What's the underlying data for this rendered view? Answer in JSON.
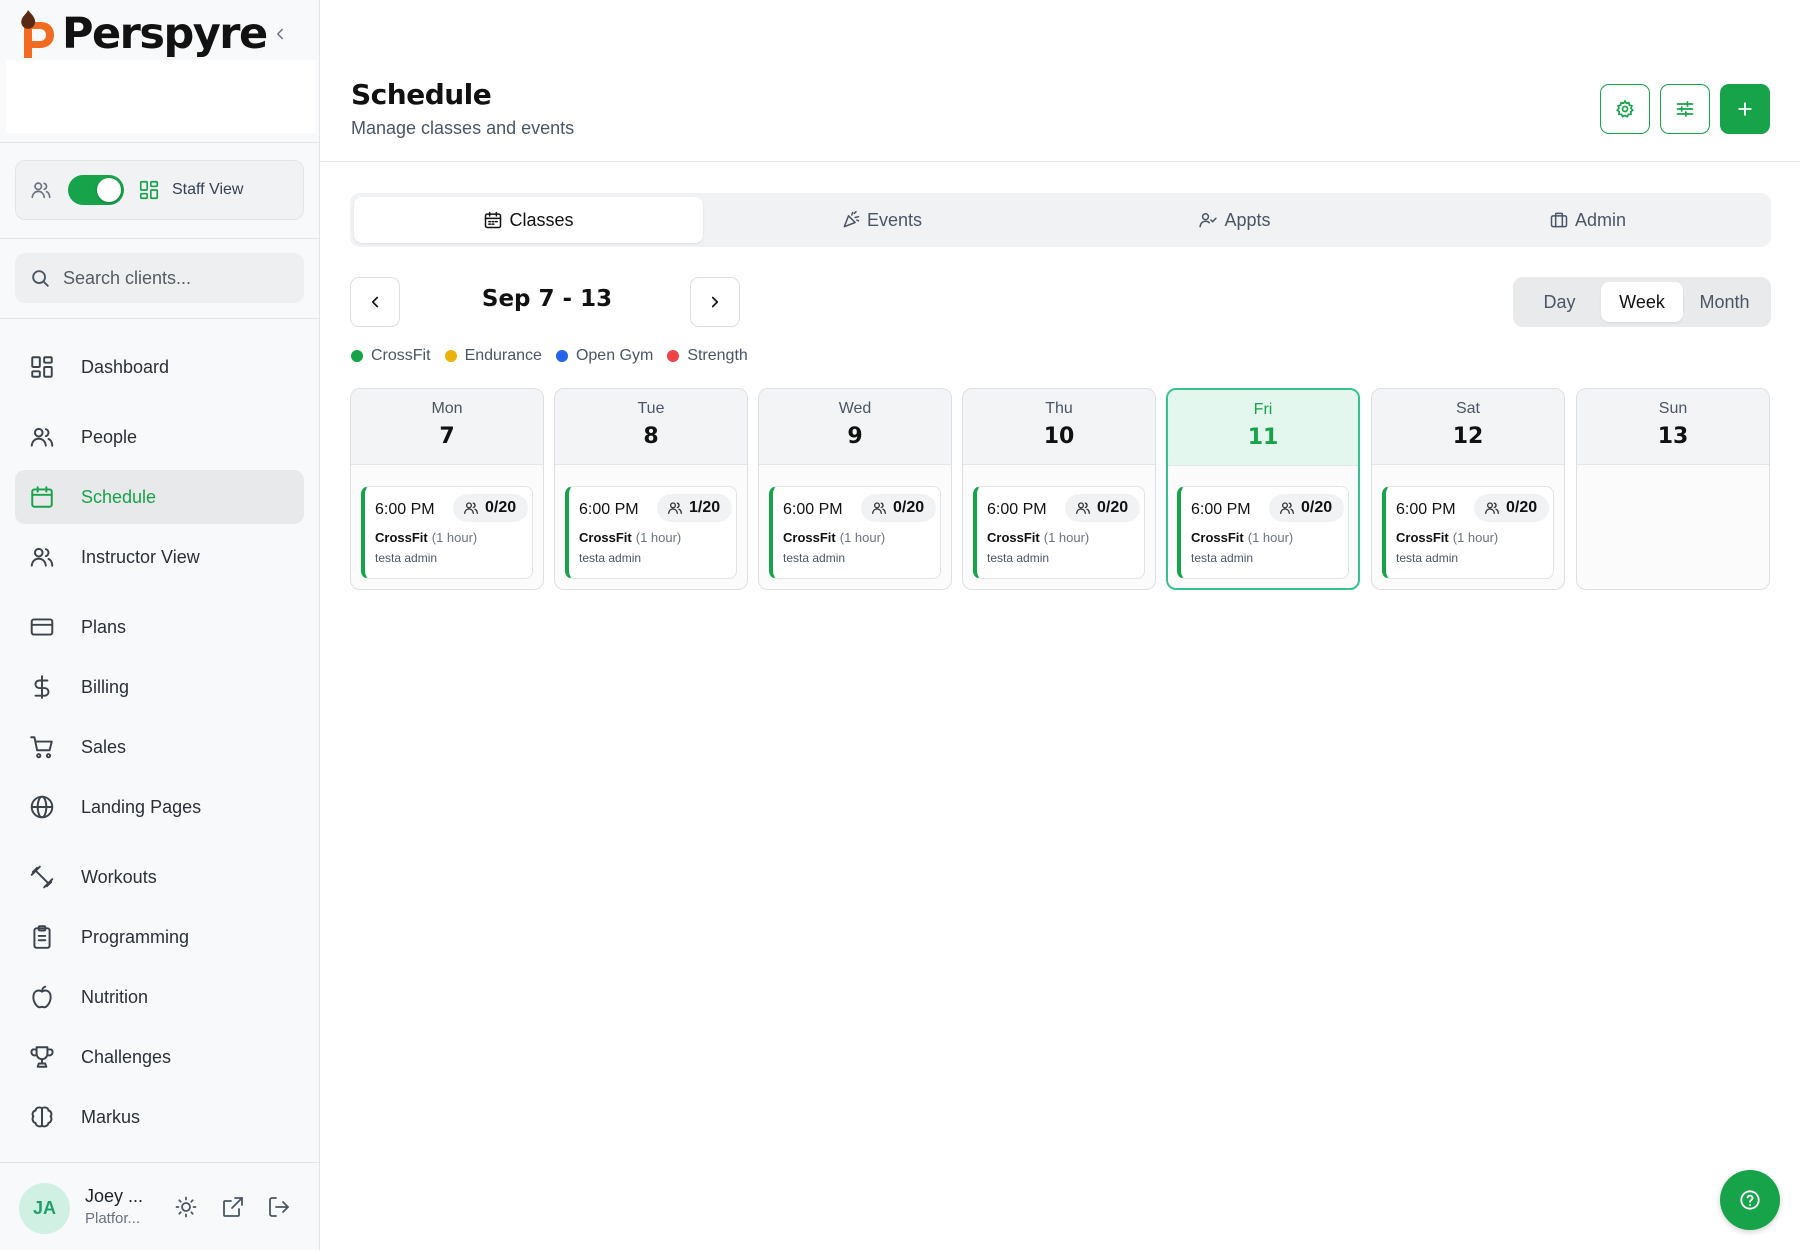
{
  "brand": {
    "name": "Perspyre",
    "accent": "#16a34a"
  },
  "view_toggle": {
    "label": "Staff View",
    "enabled": true
  },
  "search": {
    "placeholder": "Search clients..."
  },
  "sidebar": {
    "items": [
      {
        "label": "Dashboard",
        "icon": "dashboard-icon"
      },
      {
        "label": "People",
        "icon": "people-icon"
      },
      {
        "label": "Schedule",
        "icon": "calendar-icon",
        "active": true
      },
      {
        "label": "Instructor View",
        "icon": "people-icon"
      },
      {
        "label": "Plans",
        "icon": "credit-card-icon"
      },
      {
        "label": "Billing",
        "icon": "dollar-icon"
      },
      {
        "label": "Sales",
        "icon": "cart-icon"
      },
      {
        "label": "Landing Pages",
        "icon": "globe-icon"
      },
      {
        "label": "Workouts",
        "icon": "dumbbell-icon"
      },
      {
        "label": "Programming",
        "icon": "clipboard-icon"
      },
      {
        "label": "Nutrition",
        "icon": "apple-icon"
      },
      {
        "label": "Challenges",
        "icon": "trophy-icon"
      },
      {
        "label": "Markus",
        "icon": "brain-icon"
      }
    ]
  },
  "user": {
    "initials": "JA",
    "name": "Joey ...",
    "role": "Platfor..."
  },
  "header": {
    "title": "Schedule",
    "subtitle": "Manage classes and events"
  },
  "tabs": [
    {
      "label": "Classes",
      "icon": "calendar-icon",
      "active": true
    },
    {
      "label": "Events",
      "icon": "party-icon"
    },
    {
      "label": "Appts",
      "icon": "user-check-icon"
    },
    {
      "label": "Admin",
      "icon": "briefcase-icon"
    }
  ],
  "calendar": {
    "range_label": "Sep 7 - 13",
    "views": [
      {
        "label": "Day"
      },
      {
        "label": "Week",
        "active": true
      },
      {
        "label": "Month"
      }
    ],
    "legend": [
      {
        "label": "CrossFit",
        "color": "#16a34a"
      },
      {
        "label": "Endurance",
        "color": "#eab308"
      },
      {
        "label": "Open Gym",
        "color": "#2563eb"
      },
      {
        "label": "Strength",
        "color": "#ef4444"
      }
    ],
    "days": [
      {
        "name": "Mon",
        "date": "7",
        "class": {
          "time": "6:00 PM",
          "capacity": "0/20",
          "name": "CrossFit",
          "duration": "(1 hour)",
          "instructor": "testa admin"
        }
      },
      {
        "name": "Tue",
        "date": "8",
        "class": {
          "time": "6:00 PM",
          "capacity": "1/20",
          "name": "CrossFit",
          "duration": "(1 hour)",
          "instructor": "testa admin"
        }
      },
      {
        "name": "Wed",
        "date": "9",
        "class": {
          "time": "6:00 PM",
          "capacity": "0/20",
          "name": "CrossFit",
          "duration": "(1 hour)",
          "instructor": "testa admin"
        }
      },
      {
        "name": "Thu",
        "date": "10",
        "class": {
          "time": "6:00 PM",
          "capacity": "0/20",
          "name": "CrossFit",
          "duration": "(1 hour)",
          "instructor": "testa admin"
        }
      },
      {
        "name": "Fri",
        "date": "11",
        "today": true,
        "class": {
          "time": "6:00 PM",
          "capacity": "0/20",
          "name": "CrossFit",
          "duration": "(1 hour)",
          "instructor": "testa admin"
        }
      },
      {
        "name": "Sat",
        "date": "12",
        "class": {
          "time": "6:00 PM",
          "capacity": "0/20",
          "name": "CrossFit",
          "duration": "(1 hour)",
          "instructor": "testa admin"
        }
      },
      {
        "name": "Sun",
        "date": "13",
        "class": null
      }
    ]
  }
}
